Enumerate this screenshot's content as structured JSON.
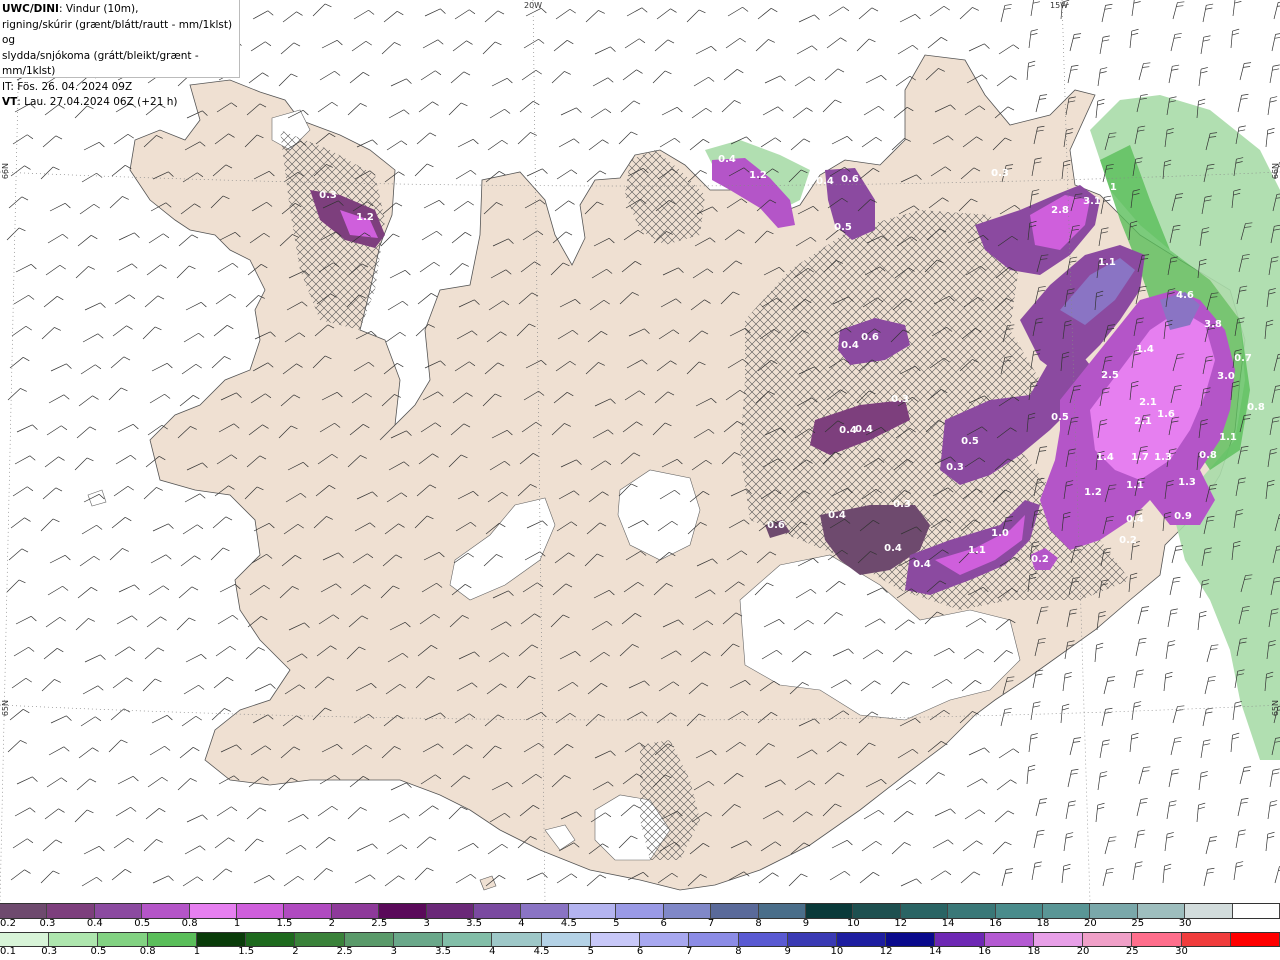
{
  "header": {
    "line1_bold": "UWC/DINI",
    "line1_rest": ": Vindur (10m),",
    "line2": "rigning/skúrir (grænt/blátt/rautt - mm/1klst) og",
    "line3": "slydda/snjókoma (grátt/bleikt/grænt - mm/1klst)",
    "line4": "IT: Fös. 26. 04. 2024 09Z",
    "line5_bold": "VT",
    "line5_rest": ": Lau. 27.04.2024 06Z (+21 h)"
  },
  "grid_labels": {
    "lon_20w": "20W",
    "lon_15w": "15W",
    "lat_66n_left": "66N",
    "lat_65n_left": "65N",
    "lat_66n_right": "66N",
    "lat_65n_right": "65N"
  },
  "map_values": [
    "0.3",
    "1.2",
    "1.2",
    "0.4",
    "0.4",
    "0.6",
    "0.5",
    "0.3",
    "2.8",
    "3.1",
    "3.1",
    "1.1",
    "4.6",
    "3.8",
    "0.7",
    "3.0",
    "0.8",
    "1.1",
    "1.4",
    "2.5",
    "2.1",
    "2.1",
    "1.6",
    "1.4",
    "1.7",
    "1.3",
    "0.8",
    "1.1",
    "1.3",
    "1.2",
    "0.4",
    "0.9",
    "0.2",
    "0.6",
    "0.4",
    "0.5",
    "0.3",
    "0.5",
    "0.3",
    "0.4",
    "0.4",
    "0.3",
    "0.4",
    "0.3",
    "0.6",
    "0.4",
    "0.4",
    "1.1",
    "1.0",
    "0.2"
  ],
  "legend": {
    "snow_labels": [
      "0.2",
      "0.3",
      "0.4",
      "0.5",
      "0.8",
      "1",
      "1.5",
      "2",
      "2.5",
      "3",
      "3.5",
      "4",
      "4.5",
      "5",
      "6",
      "7",
      "8",
      "9",
      "10",
      "12",
      "14",
      "16",
      "18",
      "20",
      "25",
      "30"
    ],
    "snow_colors": [
      "#6e4a6e",
      "#7d3f7d",
      "#8b4aa0",
      "#b455c8",
      "#e67ff0",
      "#cf5fdc",
      "#b04ac0",
      "#8e3a9a",
      "#5a0a5a",
      "#6a2878",
      "#7a4aa0",
      "#8a74c4",
      "#b4b4f0",
      "#9a9ae6",
      "#8088c8",
      "#5a6a9a",
      "#4a6e8a",
      "#0a3a3a",
      "#1e5050",
      "#2a6464",
      "#3a7878",
      "#4a8c8c",
      "#5a9696",
      "#7aa8aa",
      "#9ebebe",
      "#d2dcdc",
      "#ffffff"
    ],
    "rain_labels": [
      "0.1",
      "0.3",
      "0.5",
      "0.8",
      "1",
      "1.5",
      "2",
      "2.5",
      "3",
      "3.5",
      "4",
      "4.5",
      "5",
      "6",
      "7",
      "8",
      "9",
      "10",
      "12",
      "14",
      "16",
      "18",
      "20",
      "25",
      "30"
    ],
    "rain_colors": [
      "#d8f4d8",
      "#aee6ae",
      "#82d282",
      "#5abe5a",
      "#0a3c0a",
      "#1e6a1e",
      "#3a823a",
      "#5a9a6a",
      "#6aa88a",
      "#82bea8",
      "#9ec8c8",
      "#b4d2e6",
      "#c8c8f8",
      "#a8a8f0",
      "#8c8ce6",
      "#5a5ad2",
      "#3a3ab4",
      "#1e1ea0",
      "#0a0a8c",
      "#6e28b4",
      "#b45ad2",
      "#e8a0e8",
      "#f0a0c8",
      "#ff6e8c",
      "#f03c3c",
      "#ff0000"
    ]
  }
}
